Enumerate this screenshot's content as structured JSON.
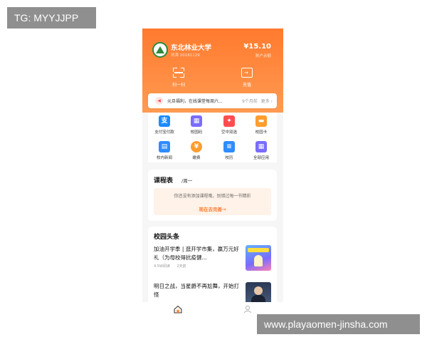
{
  "watermark": {
    "top": "TG: MYYJJPP",
    "bottom": "www.playaomen-jinsha.com"
  },
  "header": {
    "university": "东北林业大学",
    "student_id": "刘涛 20181129",
    "balance": "¥15.10",
    "balance_label": "账户余额",
    "actions": [
      {
        "label": "扫一扫",
        "icon": "scan-icon"
      },
      {
        "label": "充值",
        "icon": "recharge-icon"
      }
    ]
  },
  "notice": {
    "icon": "megaphone-icon",
    "text": "元旦福利，在线课堂每周六...",
    "time": "9个月前",
    "more": "更多 ›"
  },
  "services": [
    {
      "label": "支付宝付款",
      "icon": "alipay-icon",
      "color": "#1a8cff",
      "glyph": "支"
    },
    {
      "label": "校园码",
      "icon": "qr-code-icon",
      "color": "#7a6cff",
      "glyph": "▦"
    },
    {
      "label": "空中双选",
      "icon": "handshake-icon",
      "color": "#ff4d4f",
      "glyph": "✦"
    },
    {
      "label": "校园卡",
      "icon": "card-icon",
      "color": "#ff9d2e",
      "glyph": "▬"
    },
    {
      "label": "校内新闻",
      "icon": "book-icon",
      "color": "#2e8cff",
      "glyph": "▤"
    },
    {
      "label": "缴费",
      "icon": "coin-icon",
      "color": "#ff9d2e",
      "glyph": "¥"
    },
    {
      "label": "校历",
      "icon": "calendar-icon",
      "color": "#2e8cff",
      "glyph": "≡"
    },
    {
      "label": "全部应用",
      "icon": "apps-icon",
      "color": "#7a6cff",
      "glyph": "▦"
    }
  ],
  "course": {
    "title": "课程表",
    "day": "/周一",
    "empty_text": "你还没有添加课程哦，别错过每一节精彩",
    "link": "现在去完善→"
  },
  "news": {
    "heading": "校园头条",
    "items": [
      {
        "title": "加油开学季 | 逛开学市集，赢万元好礼（为母校得抗疫健...",
        "views": "4.5W阅读",
        "time": "2天前",
        "thumb_text": "加油开学季"
      },
      {
        "title": "明日之战，当星爵不再尬舞，开始打怪",
        "views": "",
        "time": "",
        "thumb_text": ""
      }
    ]
  },
  "tabbar": {
    "home_icon": "home-icon",
    "profile_icon": "profile-icon"
  },
  "colors": {
    "brand_orange": "#ff7a2e",
    "page_bg": "#f6f6f6"
  }
}
